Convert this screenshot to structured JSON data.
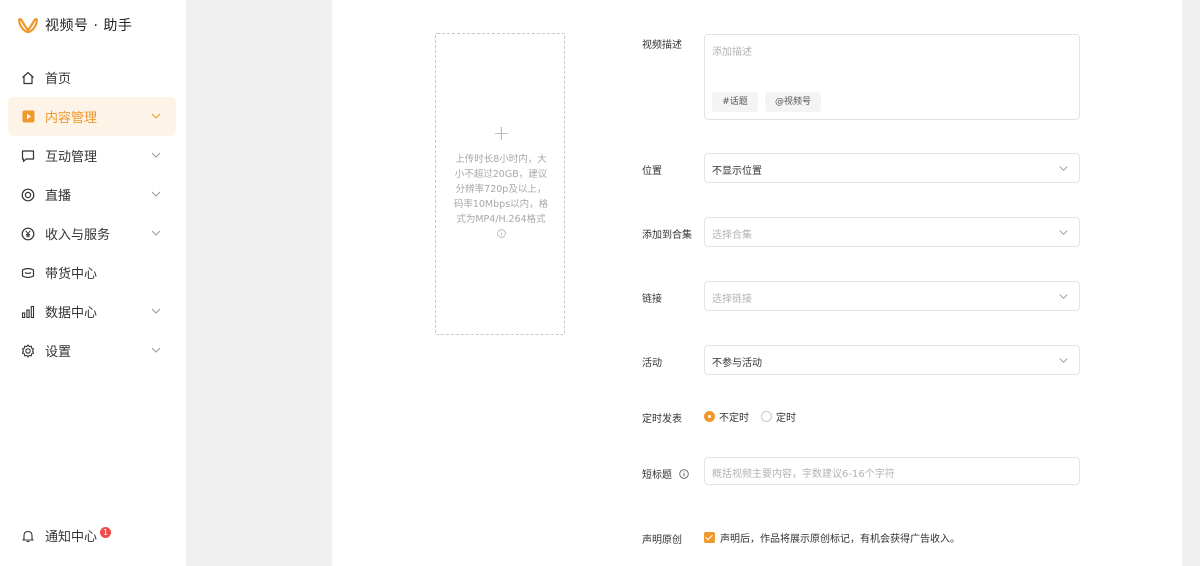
{
  "brand": {
    "name": "视频号 · 助手",
    "logo_icon": "wechat-channels-logo-icon",
    "accent": "#f0982c"
  },
  "sidebar": {
    "items": [
      {
        "label": "首页",
        "icon": "home-icon",
        "has_chevron": false,
        "active": false
      },
      {
        "label": "内容管理",
        "icon": "content-play-icon",
        "has_chevron": true,
        "active": true
      },
      {
        "label": "互动管理",
        "icon": "comment-icon",
        "has_chevron": true,
        "active": false
      },
      {
        "label": "直播",
        "icon": "live-icon",
        "has_chevron": true,
        "active": false
      },
      {
        "label": "收入与服务",
        "icon": "yen-icon",
        "has_chevron": true,
        "active": false
      },
      {
        "label": "带货中心",
        "icon": "shop-icon",
        "has_chevron": false,
        "active": false
      },
      {
        "label": "数据中心",
        "icon": "bar-chart-icon",
        "has_chevron": true,
        "active": false
      },
      {
        "label": "设置",
        "icon": "gear-icon",
        "has_chevron": true,
        "active": false
      }
    ],
    "notify": {
      "label": "通知中心",
      "badge": "1",
      "icon": "bell-icon"
    }
  },
  "upload": {
    "plus": "+",
    "tip": "上传时长8小时内，大小不超过20GB，建议分辨率720p及以上，码率10Mbps以内，格式为MP4/H.264格式"
  },
  "form": {
    "description": {
      "label": "视频描述",
      "placeholder": "添加描述",
      "tags": [
        "#话题",
        "@视频号"
      ]
    },
    "location": {
      "label": "位置",
      "value": "不显示位置"
    },
    "collection": {
      "label": "添加到合集",
      "placeholder": "选择合集"
    },
    "link": {
      "label": "链接",
      "placeholder": "选择链接"
    },
    "activity": {
      "label": "活动",
      "value": "不参与活动"
    },
    "schedule": {
      "label": "定时发表",
      "options": [
        "不定时",
        "定时"
      ],
      "selected": "不定时"
    },
    "short_title": {
      "label": "短标题",
      "placeholder": "概括视频主要内容，字数建议6-16个字符"
    },
    "original": {
      "label": "声明原创",
      "checked": true,
      "text": "声明后，作品将展示原创标记，有机会获得广告收入。"
    }
  }
}
